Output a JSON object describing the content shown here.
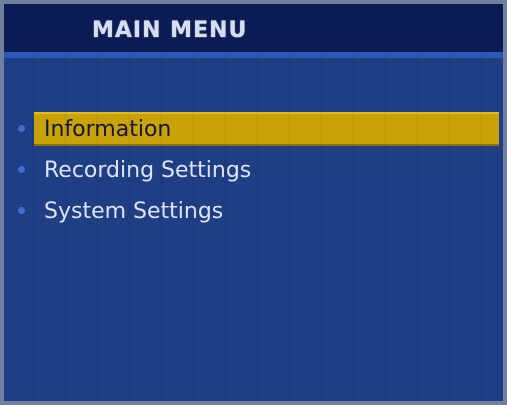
{
  "header": {
    "title": "MAIN MENU"
  },
  "menu": {
    "items": [
      {
        "label": "Information",
        "selected": true
      },
      {
        "label": "Recording Settings",
        "selected": false
      },
      {
        "label": "System Settings",
        "selected": false
      }
    ]
  },
  "colors": {
    "background": "#1e3f84",
    "header": "#0b1c55",
    "selection": "#c9a305"
  }
}
